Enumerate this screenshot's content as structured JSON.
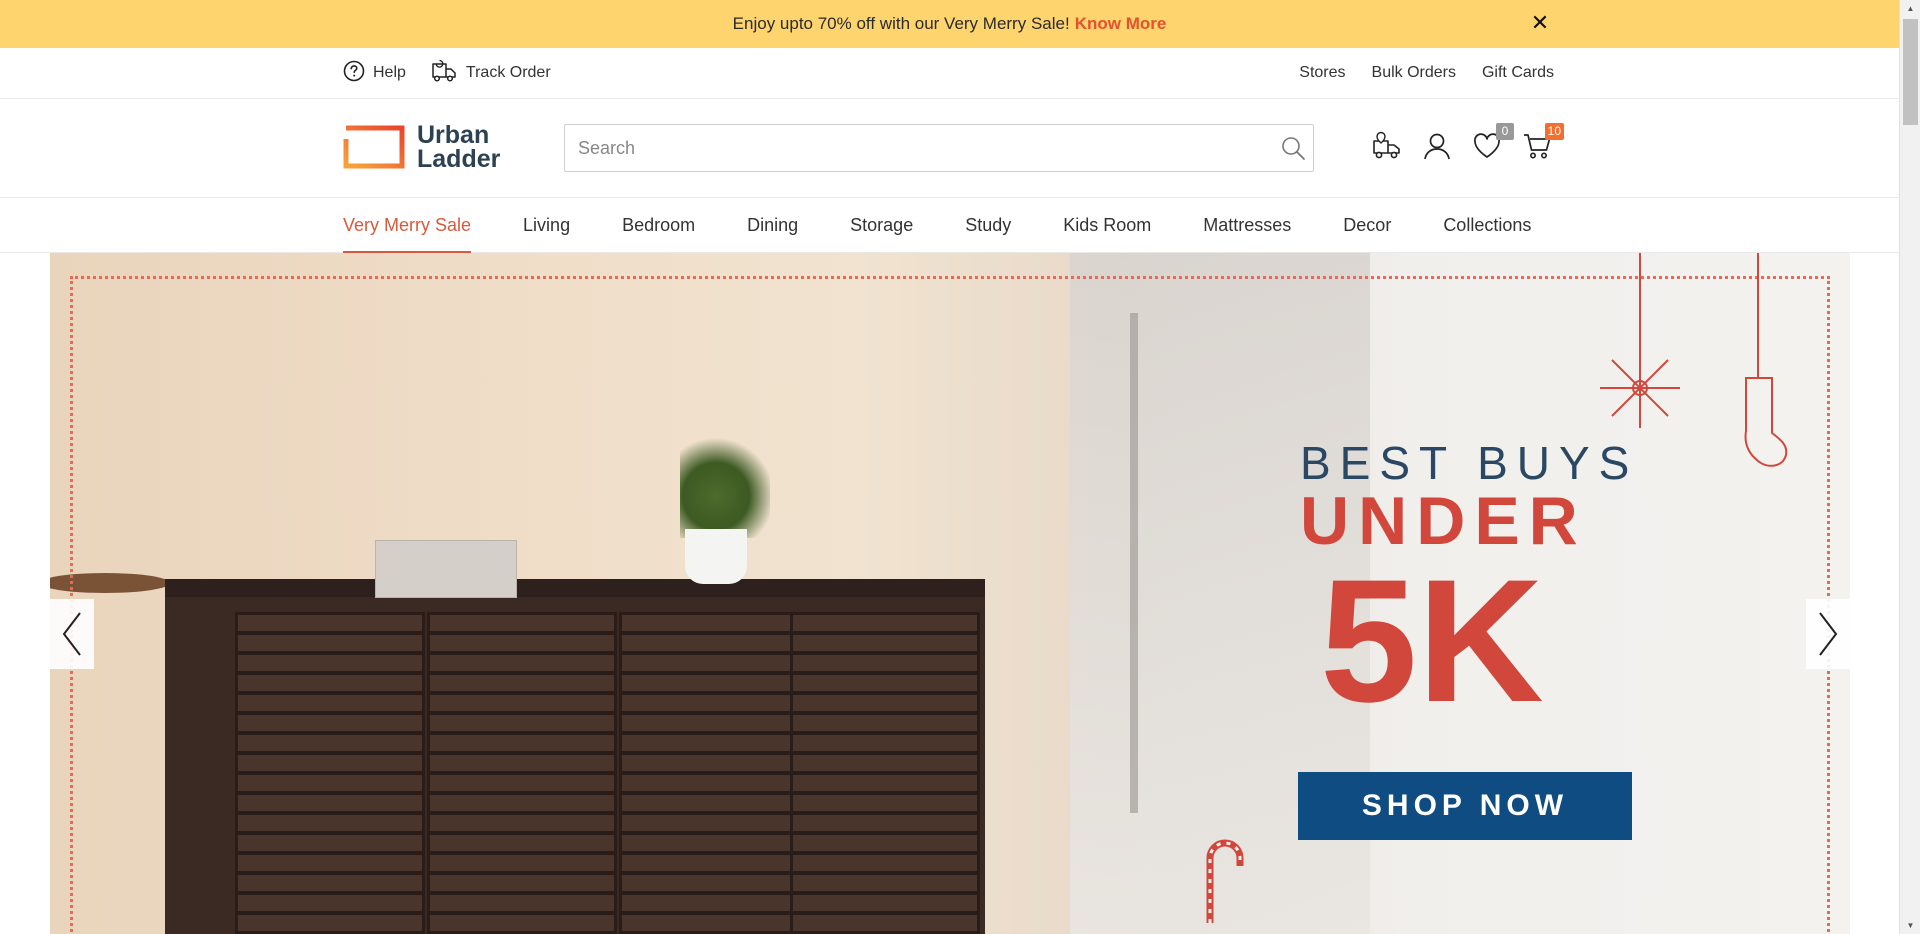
{
  "promo": {
    "text": "Enjoy upto 70% off with our Very Merry Sale!",
    "link": "Know More",
    "close": "✕"
  },
  "util": {
    "left": [
      {
        "label": "Help",
        "icon": "help-circle-icon"
      },
      {
        "label": "Track Order",
        "icon": "truck-icon"
      }
    ],
    "right": [
      "Stores",
      "Bulk Orders",
      "Gift Cards"
    ]
  },
  "header": {
    "logo_line1": "Urban",
    "logo_line2": "Ladder",
    "search_placeholder": "Search",
    "search_value": "",
    "wishlist_count": "0",
    "cart_count": "10"
  },
  "nav": {
    "items": [
      "Very Merry Sale",
      "Living",
      "Bedroom",
      "Dining",
      "Storage",
      "Study",
      "Kids Room",
      "Mattresses",
      "Decor",
      "Collections"
    ],
    "active": "Very Merry Sale"
  },
  "hero": {
    "line1": "BEST BUYS",
    "line2": "UNDER",
    "line3": "5K",
    "cta": "SHOP NOW"
  },
  "colors": {
    "promo_bg": "#fed46e",
    "accent": "#d65a3b",
    "hero_red": "#d2473c",
    "hero_navy": "#0f4c81",
    "badge_orange": "#f26f30"
  }
}
